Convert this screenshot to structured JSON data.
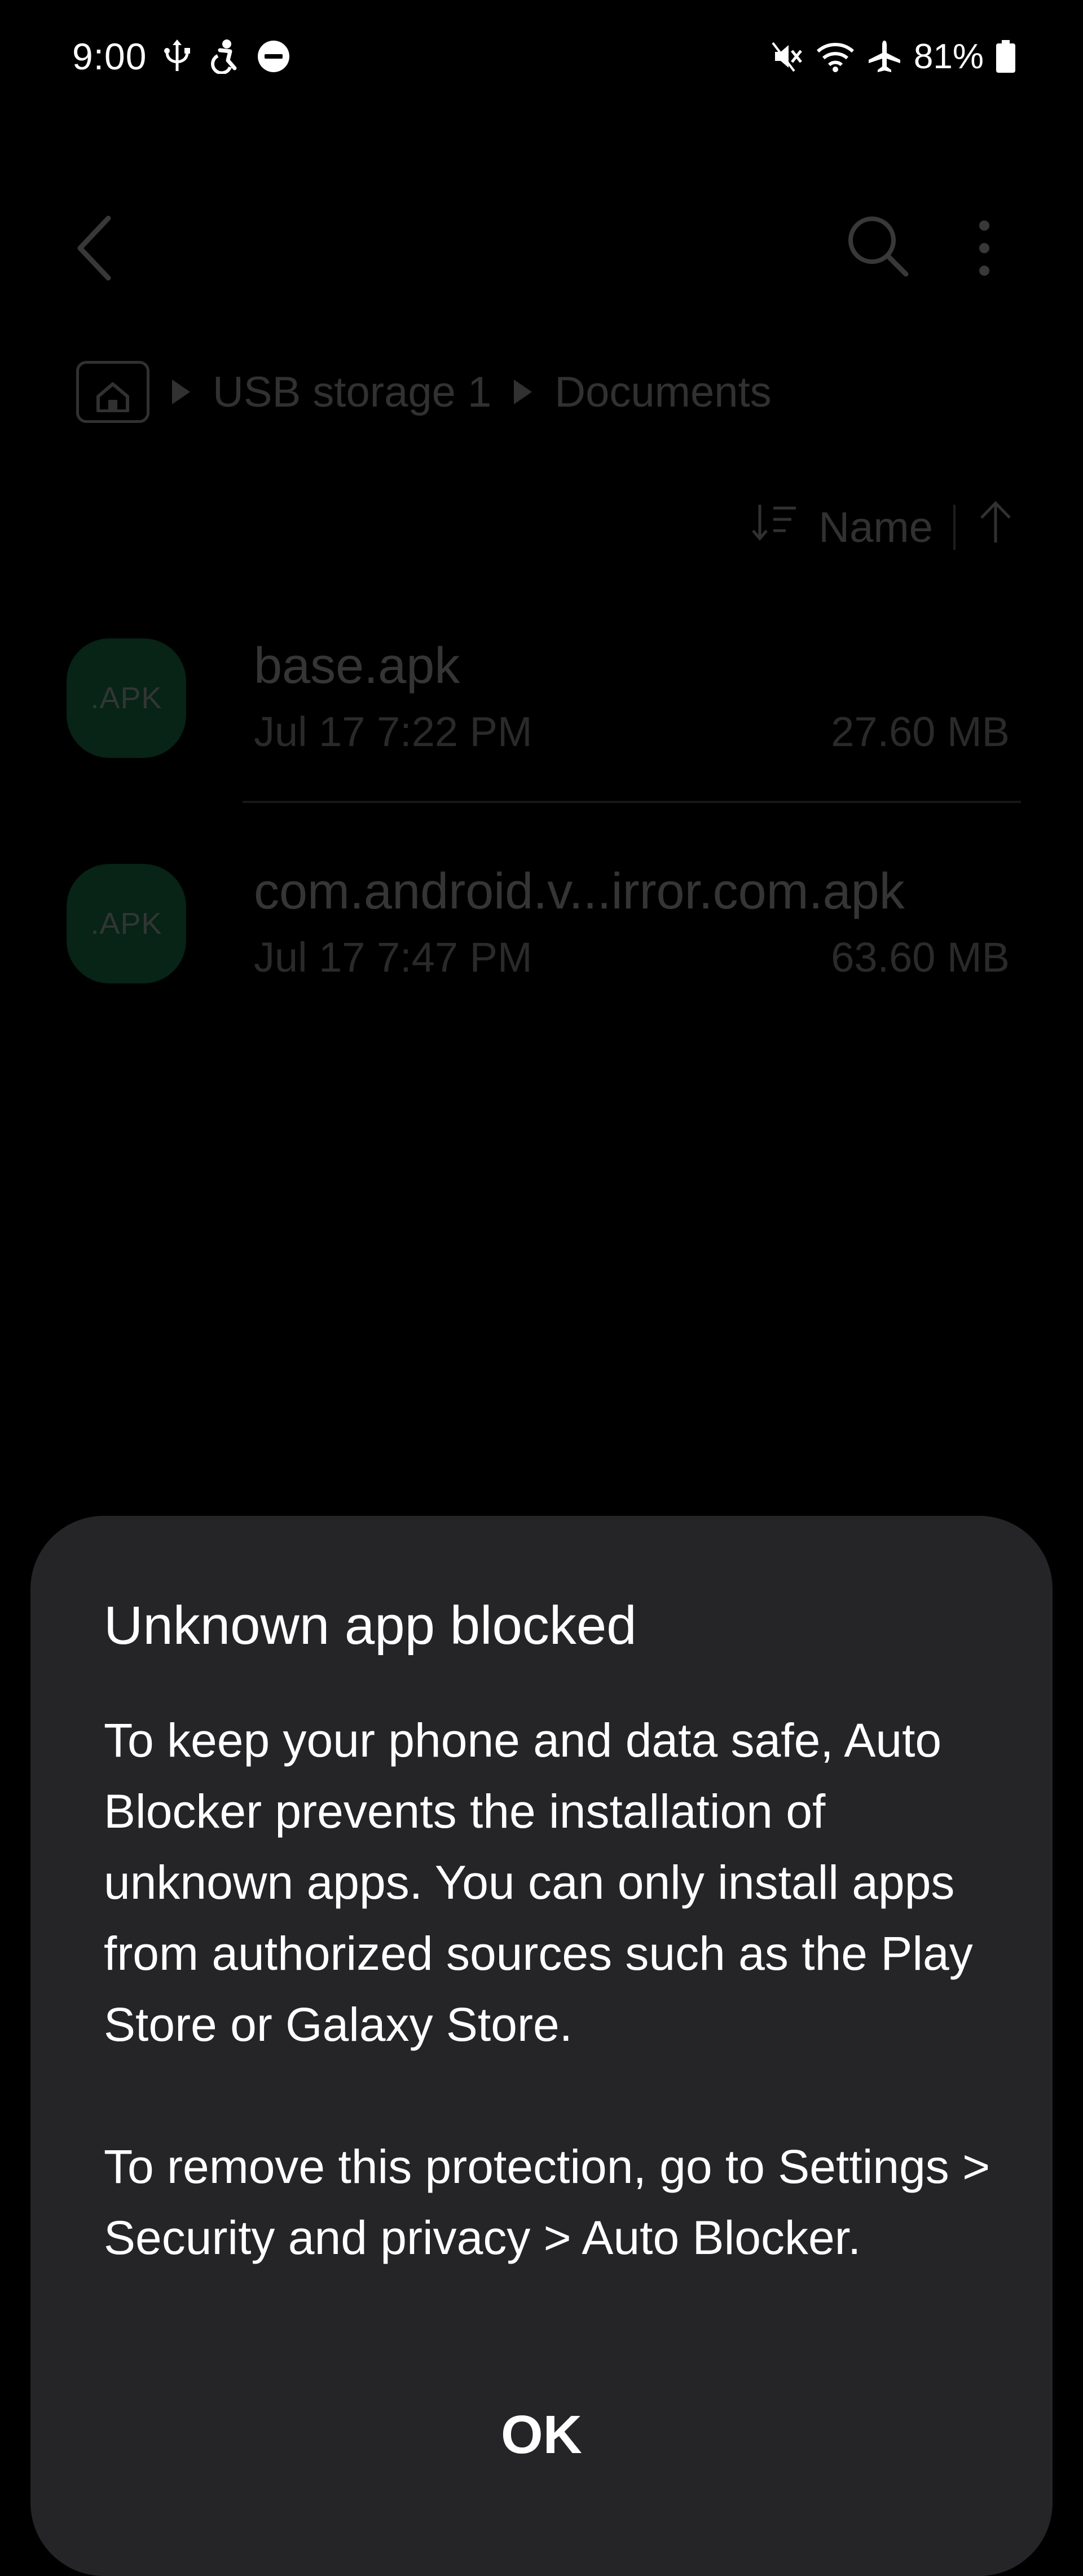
{
  "status_bar": {
    "time": "9:00",
    "battery": "81%",
    "left_icons": [
      "usb-icon",
      "accessibility-icon",
      "do-not-disturb-icon"
    ],
    "right_icons": [
      "mute-icon",
      "wifi-icon",
      "airplane-icon",
      "battery-icon"
    ]
  },
  "toolbar": {
    "icons": [
      "back-icon",
      "search-icon",
      "more-options-icon"
    ]
  },
  "breadcrumb": {
    "items": [
      "USB storage 1",
      "Documents"
    ]
  },
  "sort": {
    "label": "Name"
  },
  "files": [
    {
      "icon_label": ".APK",
      "name": "base.apk",
      "date": "Jul 17 7:22 PM",
      "size": "27.60 MB"
    },
    {
      "icon_label": ".APK",
      "name": "com.android.v...irror.com.apk",
      "date": "Jul 17 7:47 PM",
      "size": "63.60 MB"
    }
  ],
  "dialog": {
    "title": "Unknown app blocked",
    "body_1": "To keep your phone and data safe, Auto Blocker prevents the installation of unknown apps. You can only install apps from authorized sources such as the Play Store or Galaxy Store.",
    "body_2": "To remove this protection, go to Settings > Security and privacy > Auto Blocker.",
    "ok_label": "OK"
  },
  "colors": {
    "background": "#000000",
    "dialog": "#252528",
    "apk_icon": "#21a466"
  }
}
